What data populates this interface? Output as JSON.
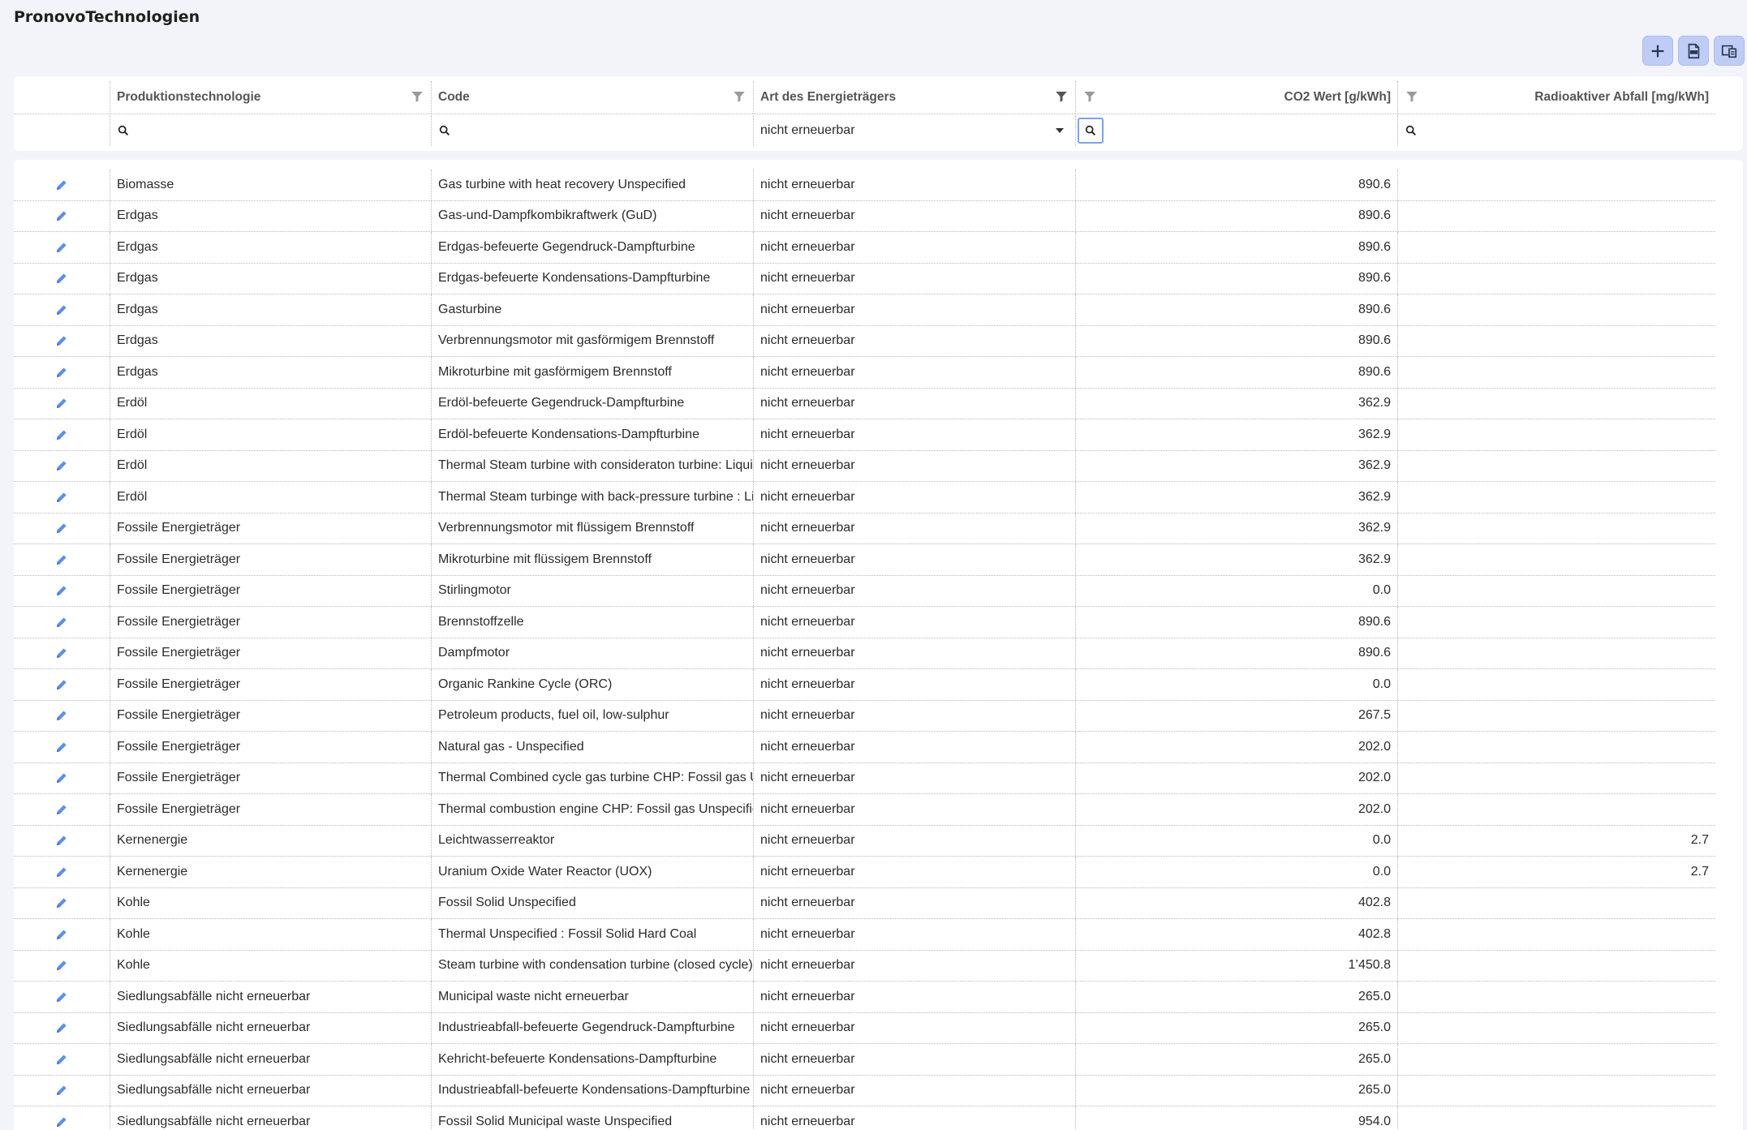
{
  "page": {
    "title": "PronovoTechnologien"
  },
  "toolbar": {
    "buttons": [
      {
        "name": "add-button",
        "icon": "plus-icon"
      },
      {
        "name": "export-csv-button",
        "icon": "csv-file-icon"
      },
      {
        "name": "column-chooser-button",
        "icon": "columns-icon"
      }
    ],
    "accent_color": "#bfcdf6"
  },
  "columns": [
    {
      "key": "edit",
      "label": ""
    },
    {
      "key": "produktionstechnologie",
      "label": "Produktionstechnologie"
    },
    {
      "key": "code",
      "label": "Code"
    },
    {
      "key": "art",
      "label": "Art des Energieträgers"
    },
    {
      "key": "co2",
      "label": "CO2 Wert [g/kWh]"
    },
    {
      "key": "radioaktiv",
      "label": "Radioaktiver Abfall [mg/kWh]"
    }
  ],
  "filters": {
    "produktionstechnologie": "",
    "code": "",
    "art": "nicht erneuerbar",
    "co2": "",
    "radioaktiv": ""
  },
  "rows": [
    [
      "Biomasse",
      "Gas turbine with heat recovery Unspecified",
      "nicht erneuerbar",
      "890.6",
      ""
    ],
    [
      "Erdgas",
      "Gas-und-Dampfkombikraftwerk (GuD)",
      "nicht erneuerbar",
      "890.6",
      ""
    ],
    [
      "Erdgas",
      "Erdgas-befeuerte Gegendruck-Dampfturbine",
      "nicht erneuerbar",
      "890.6",
      ""
    ],
    [
      "Erdgas",
      "Erdgas-befeuerte Kondensations-Dampfturbine",
      "nicht erneuerbar",
      "890.6",
      ""
    ],
    [
      "Erdgas",
      "Gasturbine",
      "nicht erneuerbar",
      "890.6",
      ""
    ],
    [
      "Erdgas",
      "Verbrennungsmotor mit gasförmigem Brennstoff",
      "nicht erneuerbar",
      "890.6",
      ""
    ],
    [
      "Erdgas",
      "Mikroturbine mit gasförmigem Brennstoff",
      "nicht erneuerbar",
      "890.6",
      ""
    ],
    [
      "Erdöl",
      "Erdöl-befeuerte Gegendruck-Dampfturbine",
      "nicht erneuerbar",
      "362.9",
      ""
    ],
    [
      "Erdöl",
      "Erdöl-befeuerte Kondensations-Dampfturbine",
      "nicht erneuerbar",
      "362.9",
      ""
    ],
    [
      "Erdöl",
      "Thermal Steam turbine with consideraton turbine: Liquid Fuel",
      "nicht erneuerbar",
      "362.9",
      ""
    ],
    [
      "Erdöl",
      "Thermal Steam turbinge with back-pressure turbine : Liquid Fuel",
      "nicht erneuerbar",
      "362.9",
      ""
    ],
    [
      "Fossile Energieträger",
      "Verbrennungsmotor mit flüssigem Brennstoff",
      "nicht erneuerbar",
      "362.9",
      ""
    ],
    [
      "Fossile Energieträger",
      "Mikroturbine mit flüssigem Brennstoff",
      "nicht erneuerbar",
      "362.9",
      ""
    ],
    [
      "Fossile Energieträger",
      "Stirlingmotor",
      "nicht erneuerbar",
      "0.0",
      ""
    ],
    [
      "Fossile Energieträger",
      "Brennstoffzelle",
      "nicht erneuerbar",
      "890.6",
      ""
    ],
    [
      "Fossile Energieträger",
      "Dampfmotor",
      "nicht erneuerbar",
      "890.6",
      ""
    ],
    [
      "Fossile Energieträger",
      "Organic Rankine Cycle (ORC)",
      "nicht erneuerbar",
      "0.0",
      ""
    ],
    [
      "Fossile Energieträger",
      "Petroleum products, fuel oil, low-sulphur",
      "nicht erneuerbar",
      "267.5",
      ""
    ],
    [
      "Fossile Energieträger",
      "Natural gas - Unspecified",
      "nicht erneuerbar",
      "202.0",
      ""
    ],
    [
      "Fossile Energieträger",
      "Thermal Combined cycle gas turbine CHP: Fossil gas Unspecified",
      "nicht erneuerbar",
      "202.0",
      ""
    ],
    [
      "Fossile Energieträger",
      "Thermal combustion engine CHP: Fossil gas Unspecified",
      "nicht erneuerbar",
      "202.0",
      ""
    ],
    [
      "Kernenergie",
      "Leichtwasserreaktor",
      "nicht erneuerbar",
      "0.0",
      "2.7"
    ],
    [
      "Kernenergie",
      "Uranium Oxide Water Reactor (UOX)",
      "nicht erneuerbar",
      "0.0",
      "2.7"
    ],
    [
      "Kohle",
      "Fossil Solid Unspecified",
      "nicht erneuerbar",
      "402.8",
      ""
    ],
    [
      "Kohle",
      "Thermal Unspecified : Fossil Solid Hard Coal",
      "nicht erneuerbar",
      "402.8",
      ""
    ],
    [
      "Kohle",
      "Steam turbine with condensation turbine (closed cycle)",
      "nicht erneuerbar",
      "1’450.8",
      ""
    ],
    [
      "Siedlungsabfälle nicht erneuerbar",
      "Municipal waste nicht erneuerbar",
      "nicht erneuerbar",
      "265.0",
      ""
    ],
    [
      "Siedlungsabfälle nicht erneuerbar",
      "Industrieabfall-befeuerte Gegendruck-Dampfturbine",
      "nicht erneuerbar",
      "265.0",
      ""
    ],
    [
      "Siedlungsabfälle nicht erneuerbar",
      "Kehricht-befeuerte Kondensations-Dampfturbine",
      "nicht erneuerbar",
      "265.0",
      ""
    ],
    [
      "Siedlungsabfälle nicht erneuerbar",
      "Industrieabfall-befeuerte Kondensations-Dampfturbine",
      "nicht erneuerbar",
      "265.0",
      ""
    ],
    [
      "Siedlungsabfälle nicht erneuerbar",
      "Fossil Solid Municipal waste Unspecified",
      "nicht erneuerbar",
      "954.0",
      ""
    ]
  ]
}
